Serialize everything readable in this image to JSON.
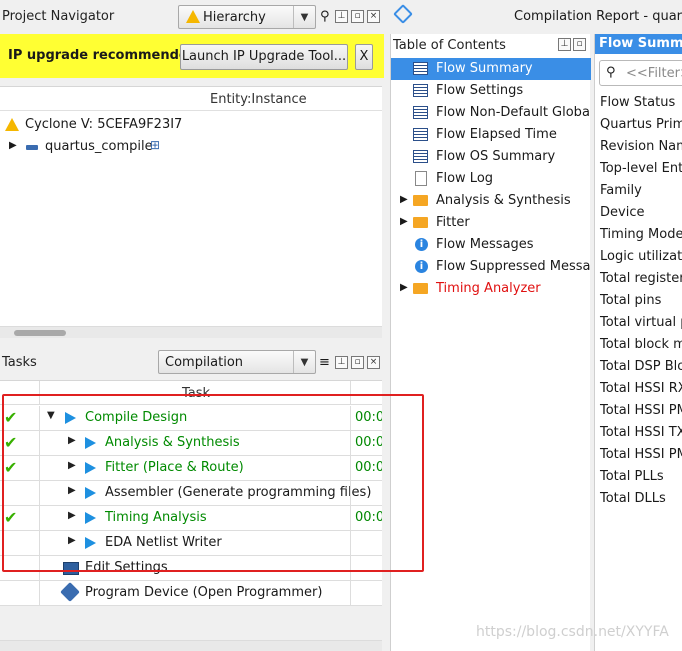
{
  "project_navigator": {
    "title": "Project Navigator",
    "view_selector": "Hierarchy",
    "ip_banner": {
      "message": "IP upgrade recommended.",
      "launch_button": "Launch IP Upgrade Tool...",
      "close_button": "X"
    },
    "column_header": "Entity:Instance",
    "tree": [
      {
        "label": "Cyclone V: 5CEFA9F23I7"
      },
      {
        "label": "quartus_compile"
      }
    ]
  },
  "tasks": {
    "title": "Tasks",
    "flow_selector": "Compilation",
    "column_header": "Task",
    "rows": [
      {
        "name": "Compile Design",
        "status": "done",
        "time": "00:0",
        "level": 0
      },
      {
        "name": "Analysis & Synthesis",
        "status": "done",
        "time": "00:0",
        "level": 1
      },
      {
        "name": "Fitter (Place & Route)",
        "status": "done",
        "time": "00:0",
        "level": 1
      },
      {
        "name": "Assembler (Generate programming files)",
        "status": "none",
        "time": "",
        "level": 1
      },
      {
        "name": "Timing Analysis",
        "status": "done",
        "time": "00:0",
        "level": 1
      },
      {
        "name": "EDA Netlist Writer",
        "status": "none",
        "time": "",
        "level": 1
      },
      {
        "name": "Edit Settings",
        "status": "none",
        "time": "",
        "level": 0
      },
      {
        "name": "Program Device (Open Programmer)",
        "status": "none",
        "time": "",
        "level": 0
      }
    ]
  },
  "compilation_report": {
    "title": "Compilation Report - quartu",
    "toc_title": "Table of Contents",
    "toc_items": [
      {
        "label": "Flow Summary",
        "icon": "table-icon",
        "selected": true
      },
      {
        "label": "Flow Settings",
        "icon": "table-icon"
      },
      {
        "label": "Flow Non-Default Global",
        "icon": "table-icon"
      },
      {
        "label": "Flow Elapsed Time",
        "icon": "table-icon"
      },
      {
        "label": "Flow OS Summary",
        "icon": "table-icon"
      },
      {
        "label": "Flow Log",
        "icon": "log-icon"
      },
      {
        "label": "Analysis & Synthesis",
        "icon": "folder-icon",
        "expandable": true
      },
      {
        "label": "Fitter",
        "icon": "folder-icon",
        "expandable": true
      },
      {
        "label": "Flow Messages",
        "icon": "info-icon"
      },
      {
        "label": "Flow Suppressed Message",
        "icon": "info-icon"
      },
      {
        "label": "Timing Analyzer",
        "icon": "folder-icon",
        "expandable": true,
        "color": "#e01010"
      }
    ],
    "flow_summary": {
      "title": "Flow Summar",
      "filter_placeholder": "<<Filter>",
      "rows": [
        "Flow Status",
        "Quartus Prime",
        "Revision Name",
        "Top-level Entit",
        "Family",
        "Device",
        "Timing Model",
        "Logic utilizatio",
        "Total registers",
        "Total pins",
        "Total virtual p",
        "Total block m",
        "Total DSP Blo",
        "Total HSSI RX",
        "Total HSSI PM",
        "Total HSSI TX",
        "Total HSSI PM",
        "Total PLLs",
        "Total DLLs"
      ]
    }
  },
  "watermark": "https://blog.csdn.net/XYYFA",
  "colors": {
    "accent": "#3a8ee6",
    "success": "#008a00",
    "highlight_box": "#e02020",
    "banner": "#ffff33"
  }
}
